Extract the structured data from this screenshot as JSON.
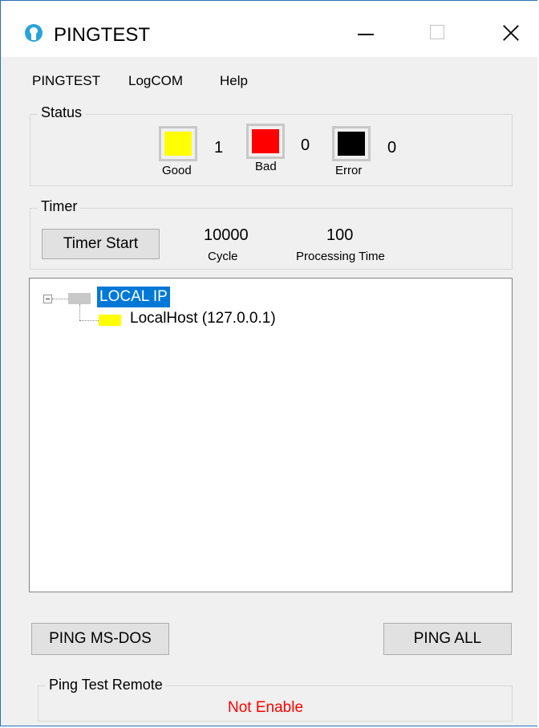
{
  "window": {
    "title": "PINGTEST",
    "icon": "app-icon"
  },
  "menu": {
    "items": [
      "PINGTEST",
      "LogCOM",
      "Help"
    ]
  },
  "status": {
    "title": "Status",
    "indicators": [
      {
        "label": "Good",
        "count": "1",
        "color": "#ffff00"
      },
      {
        "label": "Bad",
        "count": "0",
        "color": "#ff0000"
      },
      {
        "label": "Error",
        "count": "0",
        "color": "#000000"
      }
    ]
  },
  "timer": {
    "title": "Timer",
    "start_label": "Timer Start",
    "cycle_value": "10000",
    "cycle_label": "Cycle",
    "processing_value": "100",
    "processing_label": "Processing Time"
  },
  "tree": {
    "root": {
      "label": "LOCAL IP",
      "icon_color": "#c8c8c8",
      "selected": true
    },
    "children": [
      {
        "label": "LocalHost (127.0.0.1)",
        "icon_color": "#ffff00"
      }
    ]
  },
  "actions": {
    "ping_msdos": "PING MS-DOS",
    "ping_all": "PING ALL"
  },
  "remote": {
    "title": "Ping Test Remote",
    "status": "Not Enable",
    "status_color": "#ff0000"
  }
}
